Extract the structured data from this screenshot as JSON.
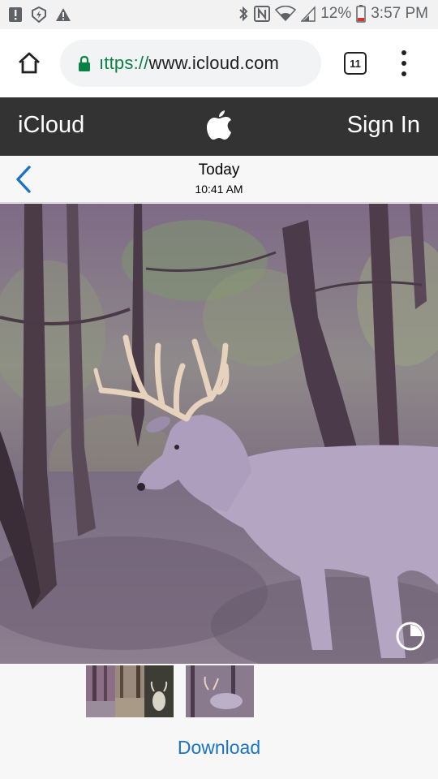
{
  "status_bar": {
    "battery": "12%",
    "time": "3:57 PM",
    "left_icons": [
      "alert-box-icon",
      "shield-icon",
      "warning-icon"
    ],
    "right_icons": [
      "bluetooth-icon",
      "nfc-icon",
      "wifi-icon",
      "signal-icon",
      "battery-icon"
    ]
  },
  "browser": {
    "url_scheme": "https://",
    "url_host": "www.icloud.com",
    "url_display_scheme": "ıttps://",
    "tab_count": "11",
    "icons": [
      "home-icon",
      "lock-icon",
      "tabs-icon",
      "menu-icon"
    ]
  },
  "header": {
    "title": "iCloud",
    "sign_in": "Sign In",
    "logo": "apple-icon"
  },
  "photo_nav": {
    "title": "Today",
    "subtitle": "10:41 AM",
    "back_icon": "chevron-left-icon"
  },
  "photo": {
    "live_icon": "live-photo-icon"
  },
  "bottom": {
    "thumbnail_count": 4,
    "download_label": "Download"
  },
  "colors": {
    "header_bg": "#333333",
    "link_blue": "#1a73c8",
    "secure_green": "#0b8043"
  }
}
